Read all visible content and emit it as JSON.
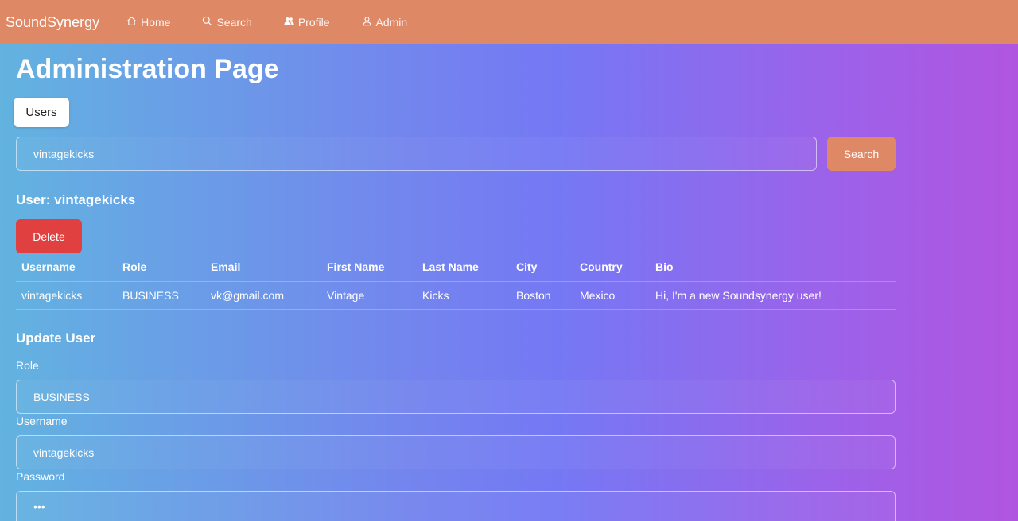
{
  "nav": {
    "brand": "SoundSynergy",
    "links": [
      {
        "label": "Home",
        "icon": "home-icon"
      },
      {
        "label": "Search",
        "icon": "search-icon"
      },
      {
        "label": "Profile",
        "icon": "users-icon"
      },
      {
        "label": "Admin",
        "icon": "user-icon"
      }
    ]
  },
  "page": {
    "title": "Administration Page",
    "tab_label": "Users"
  },
  "search": {
    "value": "vintagekicks",
    "button_label": "Search"
  },
  "user_section": {
    "heading": "User: vintagekicks",
    "delete_label": "Delete"
  },
  "table": {
    "headers": [
      "Username",
      "Role",
      "Email",
      "First Name",
      "Last Name",
      "City",
      "Country",
      "Bio"
    ],
    "rows": [
      [
        "vintagekicks",
        "BUSINESS",
        "vk@gmail.com",
        "Vintage",
        "Kicks",
        "Boston",
        "Mexico",
        "Hi, I'm a new Soundsynergy user!"
      ]
    ]
  },
  "update": {
    "heading": "Update User",
    "role_label": "Role",
    "role_value": "BUSINESS",
    "username_label": "Username",
    "username_value": "vintagekicks",
    "password_label": "Password",
    "password_value": "•••"
  },
  "colors": {
    "navbar": "#df8866",
    "search_button": "#df8866",
    "delete_button": "#e0403f",
    "gradient_start": "#62b3e0",
    "gradient_end": "#b155e0"
  }
}
